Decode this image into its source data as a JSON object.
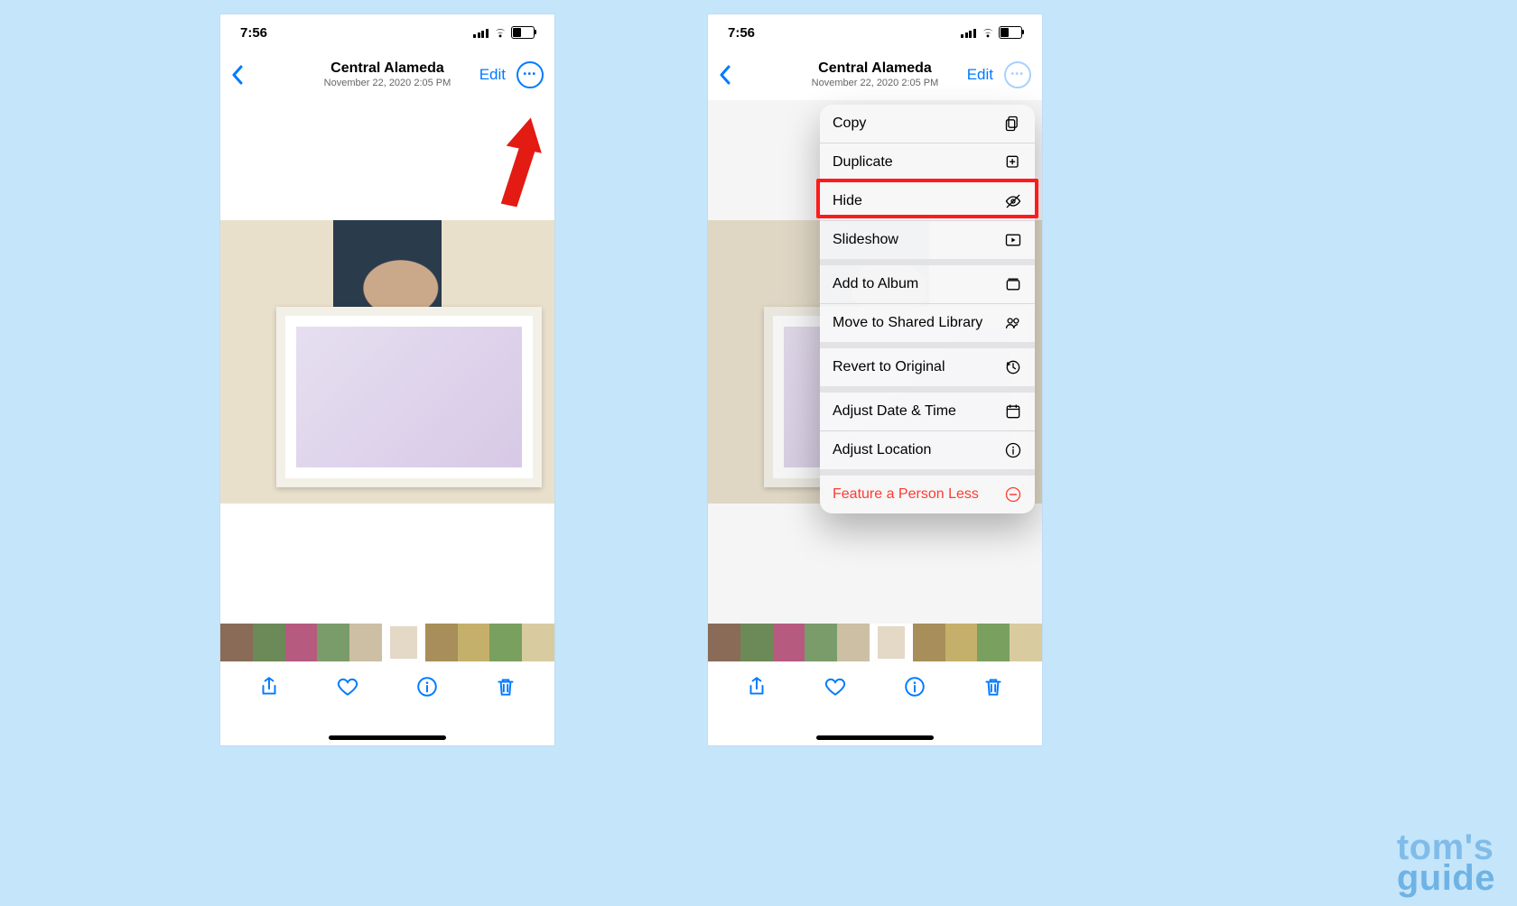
{
  "watermark": {
    "line1": "tom's",
    "line2": "guide"
  },
  "status": {
    "time": "7:56"
  },
  "header": {
    "title": "Central Alameda",
    "subtitle": "November 22, 2020  2:05 PM",
    "edit": "Edit"
  },
  "menu": {
    "items": [
      {
        "label": "Copy",
        "icon": "copy-icon"
      },
      {
        "label": "Duplicate",
        "icon": "duplicate-icon"
      },
      {
        "label": "Hide",
        "icon": "eye-slash-icon",
        "highlight": true
      },
      {
        "label": "Slideshow",
        "icon": "play-rect-icon"
      },
      {
        "label": "Add to Album",
        "icon": "album-icon",
        "group": true
      },
      {
        "label": "Move to Shared Library",
        "icon": "people-icon"
      },
      {
        "label": "Revert to Original",
        "icon": "revert-icon",
        "group": true
      },
      {
        "label": "Adjust Date & Time",
        "icon": "calendar-icon",
        "group": true
      },
      {
        "label": "Adjust Location",
        "icon": "info-icon"
      },
      {
        "label": "Feature a Person Less",
        "icon": "minus-circle-icon",
        "group": true,
        "destructive": true
      }
    ]
  }
}
